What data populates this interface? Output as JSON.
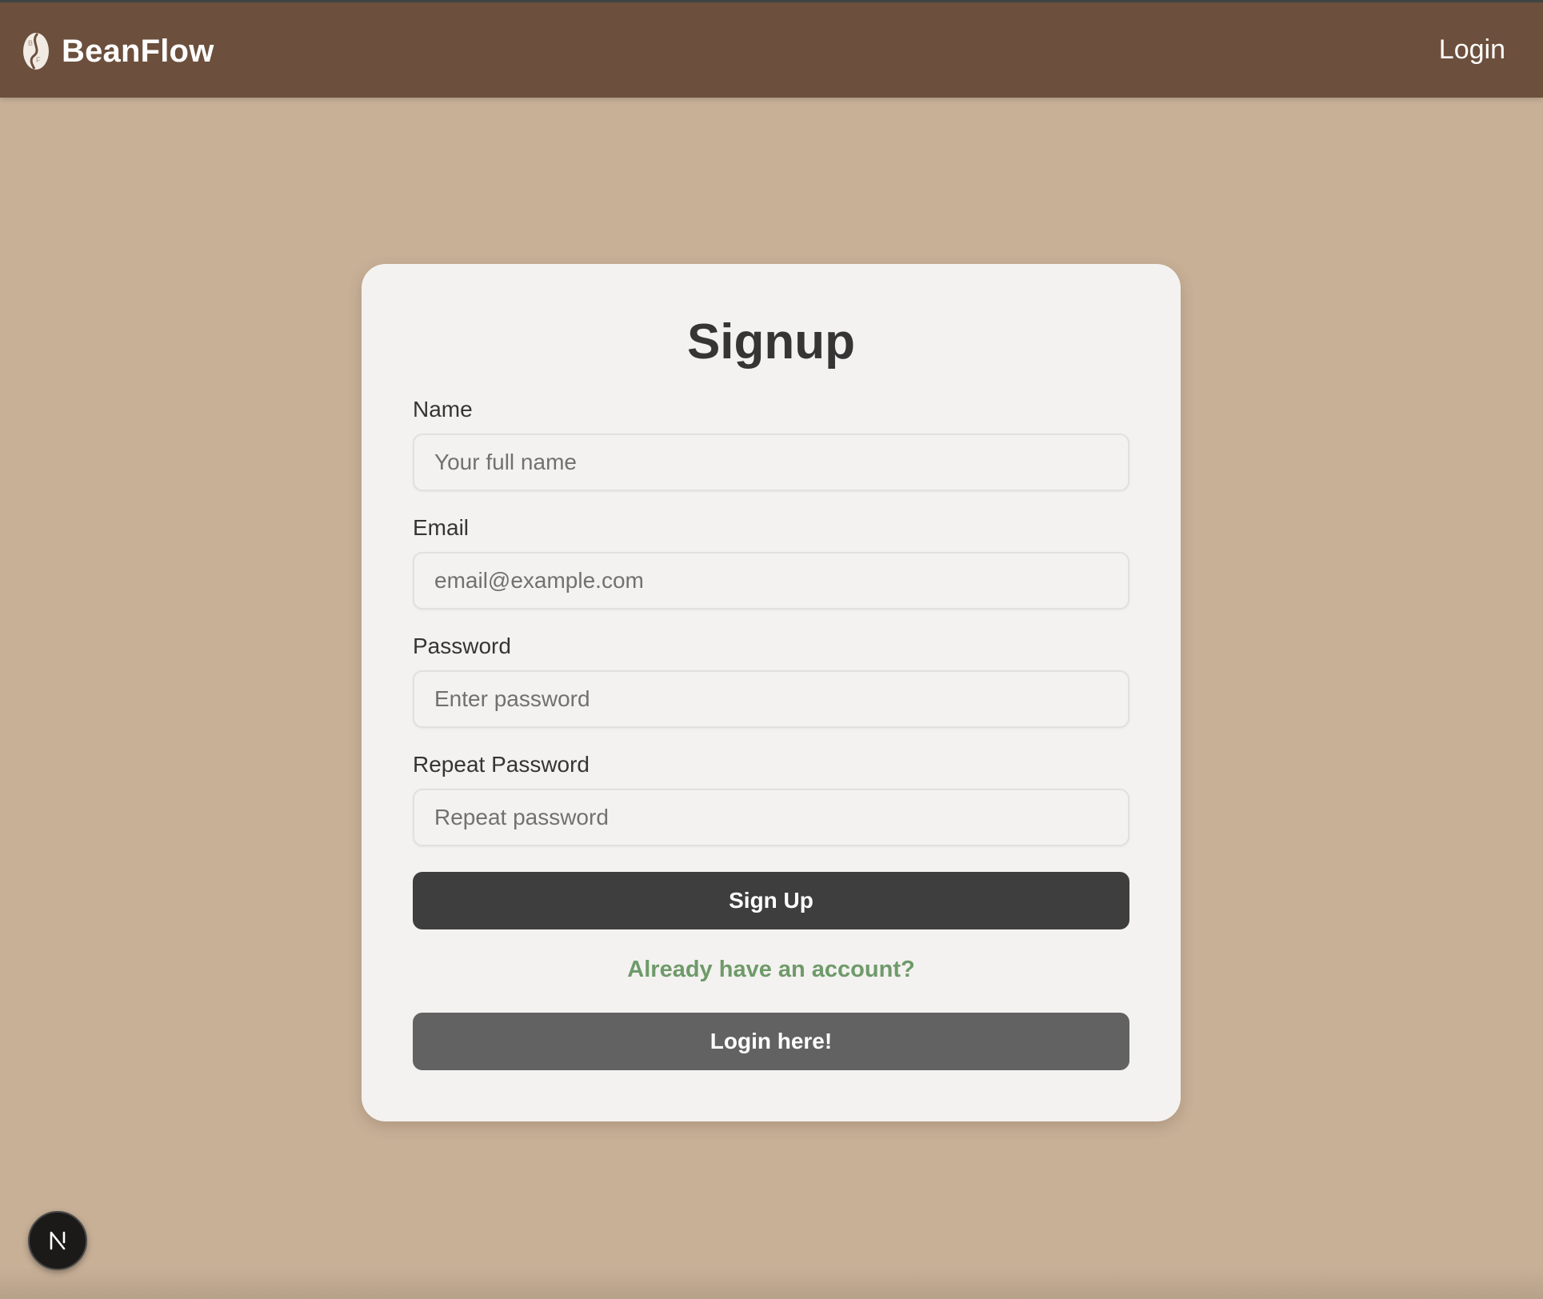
{
  "navbar": {
    "brand_name": "BeanFlow",
    "logo_icon": "coffee-bean-icon",
    "login_link": "Login"
  },
  "form": {
    "title": "Signup",
    "fields": [
      {
        "label": "Name",
        "placeholder": "Your full name",
        "value": ""
      },
      {
        "label": "Email",
        "placeholder": "email@example.com",
        "value": ""
      },
      {
        "label": "Password",
        "placeholder": "Enter password",
        "value": ""
      },
      {
        "label": "Repeat Password",
        "placeholder": "Repeat password",
        "value": ""
      }
    ],
    "submit_label": "Sign Up",
    "already_text": "Already have an account?",
    "login_button_label": "Login here!"
  },
  "dev_badge": {
    "icon": "nextjs-n-icon"
  },
  "colors": {
    "page_background": "#c8b097",
    "navbar": "#6c4f3c",
    "card": "#f3f2f0",
    "primary_button": "#3e3e3e",
    "secondary_button": "#626262",
    "link_green": "#6f9a6a"
  }
}
